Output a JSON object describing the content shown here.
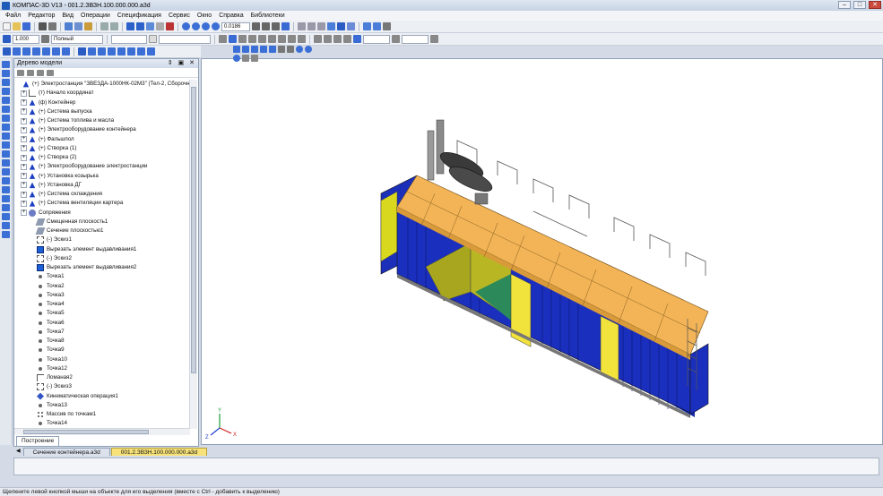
{
  "window": {
    "title": "КОМПАС-3D V13 - 001.2.ЗВЗН.100.000.000.a3d",
    "controls": {
      "minimize": "–",
      "maximize": "□",
      "close": "✕"
    }
  },
  "menu": [
    "Файл",
    "Редактор",
    "Вид",
    "Операции",
    "Спецификация",
    "Сервис",
    "Окно",
    "Справка",
    "Библиотеки"
  ],
  "toolbar": {
    "zoom_value": "0.0186",
    "scale_value": "1.000",
    "view_mode": "Полный"
  },
  "tree": {
    "header": "Дерево модели",
    "header_buttons": "⇕ ▣ ✕",
    "tab_label": "Построение",
    "items": [
      {
        "text": "(+) Электростанция \"ЗВЕЗДА-1000НК-02М3\" (Тел-2, Сборочны",
        "icon": "assembly-icon",
        "level": 0,
        "exp": ""
      },
      {
        "text": "(т) Начало координат",
        "icon": "origin-icon",
        "level": 1,
        "exp": "+"
      },
      {
        "text": "(ф) Контейнер",
        "icon": "assembly-icon",
        "level": 1,
        "exp": "+"
      },
      {
        "text": "(+) Система выпуска",
        "icon": "assembly-icon",
        "level": 1,
        "exp": "+"
      },
      {
        "text": "(+) Система топлива и масла",
        "icon": "assembly-icon",
        "level": 1,
        "exp": "+"
      },
      {
        "text": "(+) Электрооборудование контейнера",
        "icon": "assembly-icon",
        "level": 1,
        "exp": "+"
      },
      {
        "text": "(+) Фальшпол",
        "icon": "assembly-icon",
        "level": 1,
        "exp": "+"
      },
      {
        "text": "(+) Створка (1)",
        "icon": "assembly-icon",
        "level": 1,
        "exp": "+"
      },
      {
        "text": "(+) Створка (2)",
        "icon": "assembly-icon",
        "level": 1,
        "exp": "+"
      },
      {
        "text": "(+) Электрооборудование электростанции",
        "icon": "assembly-icon",
        "level": 1,
        "exp": "+"
      },
      {
        "text": "(+) Установка козырька",
        "icon": "assembly-icon",
        "level": 1,
        "exp": "+"
      },
      {
        "text": "(+) Установка ДГ",
        "icon": "assembly-icon",
        "level": 1,
        "exp": "+"
      },
      {
        "text": "(+) Система охлаждения",
        "icon": "assembly-icon",
        "level": 1,
        "exp": "+"
      },
      {
        "text": "(+) Система вентиляции картера",
        "icon": "assembly-icon",
        "level": 1,
        "exp": "+"
      },
      {
        "text": "Сопряжения",
        "icon": "mate-icon",
        "level": 1,
        "exp": "+"
      },
      {
        "text": "Смещенная плоскость1",
        "icon": "plane-icon",
        "level": 2,
        "exp": ""
      },
      {
        "text": "Сечение плоскостью1",
        "icon": "section-icon",
        "level": 2,
        "exp": ""
      },
      {
        "text": "(-) Эскиз1",
        "icon": "sketch-icon",
        "level": 2,
        "exp": ""
      },
      {
        "text": "Вырезать элемент выдавливания1",
        "icon": "cut-icon",
        "level": 2,
        "exp": ""
      },
      {
        "text": "(-) Эскиз2",
        "icon": "sketch-icon",
        "level": 2,
        "exp": ""
      },
      {
        "text": "Вырезать элемент выдавливания2",
        "icon": "cut-icon",
        "level": 2,
        "exp": ""
      },
      {
        "text": "Точка1",
        "icon": "point-icon",
        "level": 2,
        "exp": ""
      },
      {
        "text": "Точка2",
        "icon": "point-icon",
        "level": 2,
        "exp": ""
      },
      {
        "text": "Точка3",
        "icon": "point-icon",
        "level": 2,
        "exp": ""
      },
      {
        "text": "Точка4",
        "icon": "point-icon",
        "level": 2,
        "exp": ""
      },
      {
        "text": "Точка5",
        "icon": "point-icon",
        "level": 2,
        "exp": ""
      },
      {
        "text": "Точка6",
        "icon": "point-icon",
        "level": 2,
        "exp": ""
      },
      {
        "text": "Точка7",
        "icon": "point-icon",
        "level": 2,
        "exp": ""
      },
      {
        "text": "Точка8",
        "icon": "point-icon",
        "level": 2,
        "exp": ""
      },
      {
        "text": "Точка9",
        "icon": "point-icon",
        "level": 2,
        "exp": ""
      },
      {
        "text": "Точка10",
        "icon": "point-icon",
        "level": 2,
        "exp": ""
      },
      {
        "text": "Точка12",
        "icon": "point-icon",
        "level": 2,
        "exp": ""
      },
      {
        "text": "Ломаная2",
        "icon": "polyline-icon",
        "level": 2,
        "exp": ""
      },
      {
        "text": "(-) Эскиз3",
        "icon": "sketch-icon",
        "level": 2,
        "exp": ""
      },
      {
        "text": "Кинематическая операция1",
        "icon": "kinematic-icon",
        "level": 2,
        "exp": ""
      },
      {
        "text": "Точка13",
        "icon": "point-icon",
        "level": 2,
        "exp": ""
      },
      {
        "text": "Массив по точкам1",
        "icon": "array-icon",
        "level": 2,
        "exp": ""
      },
      {
        "text": "Точка14",
        "icon": "point-icon",
        "level": 2,
        "exp": ""
      }
    ]
  },
  "document_tabs": [
    {
      "label": "Сечение контейнера.a3d",
      "active": false
    },
    {
      "label": "001.2.ЗВЗН.100.000.000.a3d",
      "active": true
    }
  ],
  "status_text": "Щелкните левой кнопкой мыши на объекте для его выделения (вместе с Ctrl - добавить к выделению)",
  "axis_labels": {
    "x": "X",
    "y": "Y",
    "z": "Z"
  }
}
